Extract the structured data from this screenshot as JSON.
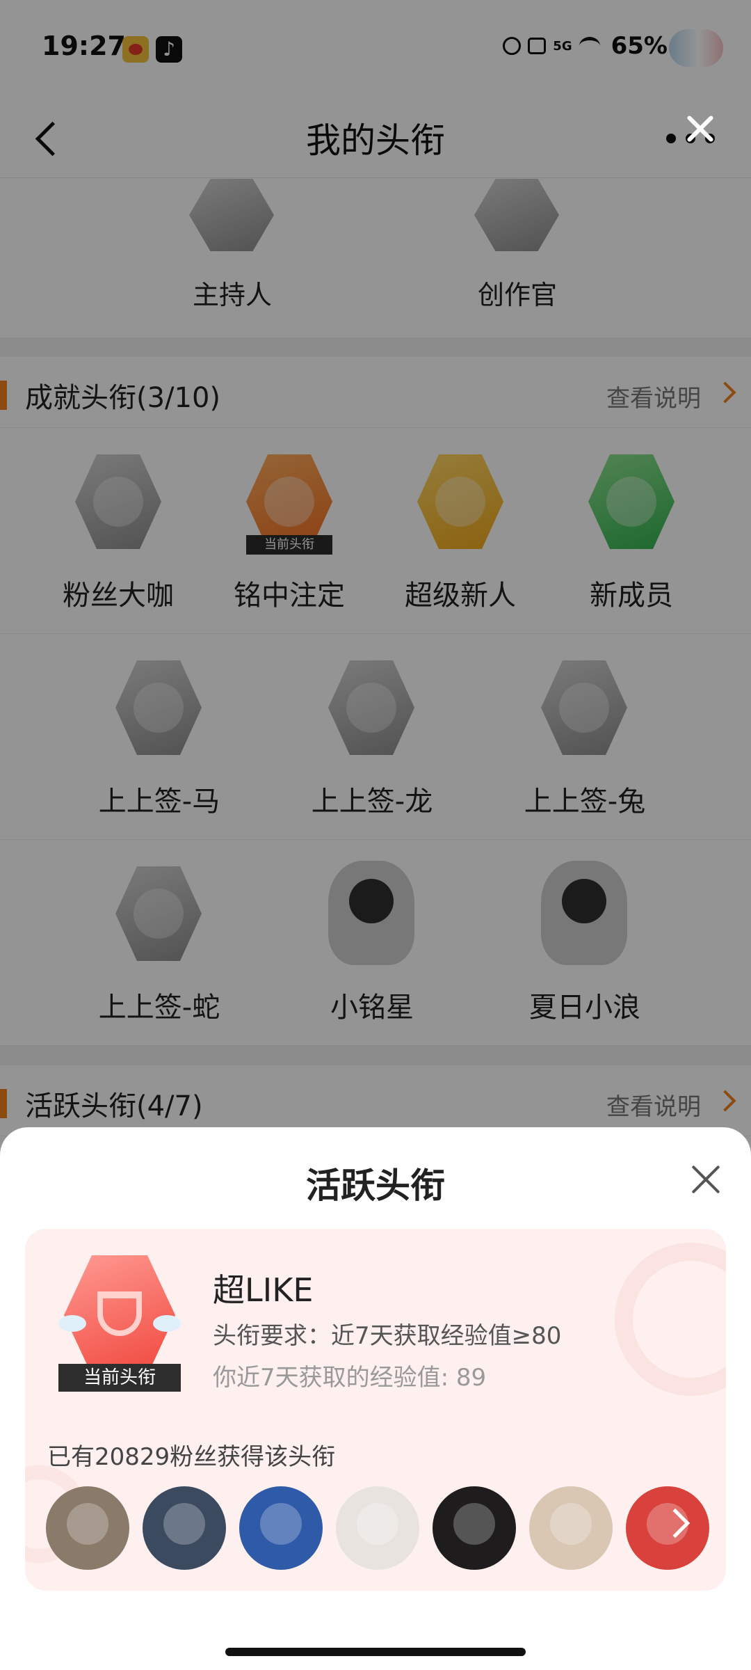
{
  "status": {
    "time": "19:27",
    "network": "5G",
    "battery": "65%"
  },
  "nav": {
    "title": "我的头衔"
  },
  "top_badges": [
    {
      "label": "主持人"
    },
    {
      "label": "创作官"
    }
  ],
  "achievement": {
    "title": "成就头衔(3/10)",
    "link": "查看说明",
    "rows": [
      [
        {
          "label": "粉丝大咖",
          "icon": "crown-badge-icon",
          "style": "grey"
        },
        {
          "label": "铭中注定",
          "icon": "lv9-badge-icon",
          "style": "orange",
          "tag": "当前头衔"
        },
        {
          "label": "超级新人",
          "icon": "hi-badge-icon",
          "style": "yellow"
        },
        {
          "label": "新成员",
          "icon": "hand-badge-icon",
          "style": "green"
        }
      ],
      [
        {
          "label": "上上签-马",
          "icon": "horse-badge-icon"
        },
        {
          "label": "上上签-龙",
          "icon": "dragon-badge-icon"
        },
        {
          "label": "上上签-兔",
          "icon": "rabbit-badge-icon"
        }
      ],
      [
        {
          "label": "上上签-蛇",
          "icon": "snake-badge-icon"
        },
        {
          "label": "小铭星",
          "icon": "boy-character-icon"
        },
        {
          "label": "夏日小浪",
          "icon": "robot-character-icon"
        }
      ]
    ]
  },
  "active": {
    "title": "活跃头衔(4/7)",
    "link": "查看说明"
  },
  "sheet": {
    "title": "活跃头衔",
    "badge_tag": "当前头衔",
    "name": "超LIKE",
    "requirement": "头衔要求：近7天获取经验值≥80",
    "experience": "你近7天获取的经验值: 89",
    "fans_count": "已有20829粉丝获得该头衔",
    "avatar_colors": [
      "#8a7a6a",
      "#3b4a5f",
      "#2e5aa8",
      "#e9e3df",
      "#1e1c1c",
      "#d9c7b4",
      "#d9423c"
    ]
  }
}
